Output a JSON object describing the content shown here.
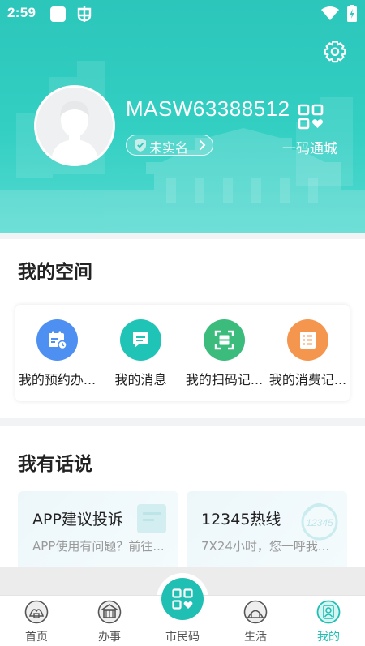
{
  "status_bar": {
    "time": "2:59"
  },
  "profile": {
    "username": "MASW63388512",
    "verify_label": "未实名",
    "city_code_label": "一码通城"
  },
  "my_space": {
    "title": "我的空间",
    "items": [
      {
        "label": "我的预约办...",
        "icon": "calendar-icon",
        "color": "#4e8ff2"
      },
      {
        "label": "我的消息",
        "icon": "message-icon",
        "color": "#20c4b6"
      },
      {
        "label": "我的扫码记...",
        "icon": "scan-icon",
        "color": "#3bbb7c"
      },
      {
        "label": "我的消费记...",
        "icon": "receipt-icon",
        "color": "#f5964e"
      }
    ]
  },
  "speak": {
    "title": "我有话说",
    "cards": [
      {
        "title": "APP建议投诉",
        "subtitle": "APP使用有问题？前往...",
        "icon": "feedback-icon"
      },
      {
        "title": "12345热线",
        "subtitle": "7X24小时，您一呼我...",
        "icon": "hotline-12345-icon"
      }
    ]
  },
  "bottom_nav": {
    "items": [
      {
        "label": "首页",
        "icon": "home-icon"
      },
      {
        "label": "办事",
        "icon": "affairs-icon"
      },
      {
        "label": "市民码",
        "icon": "citizen-code-icon"
      },
      {
        "label": "生活",
        "icon": "life-icon"
      },
      {
        "label": "我的",
        "icon": "mine-icon",
        "active": true
      }
    ]
  },
  "colors": {
    "primary": "#1fbfb3",
    "header": "#2cc6bb",
    "text": "#222222",
    "muted": "#999999"
  }
}
